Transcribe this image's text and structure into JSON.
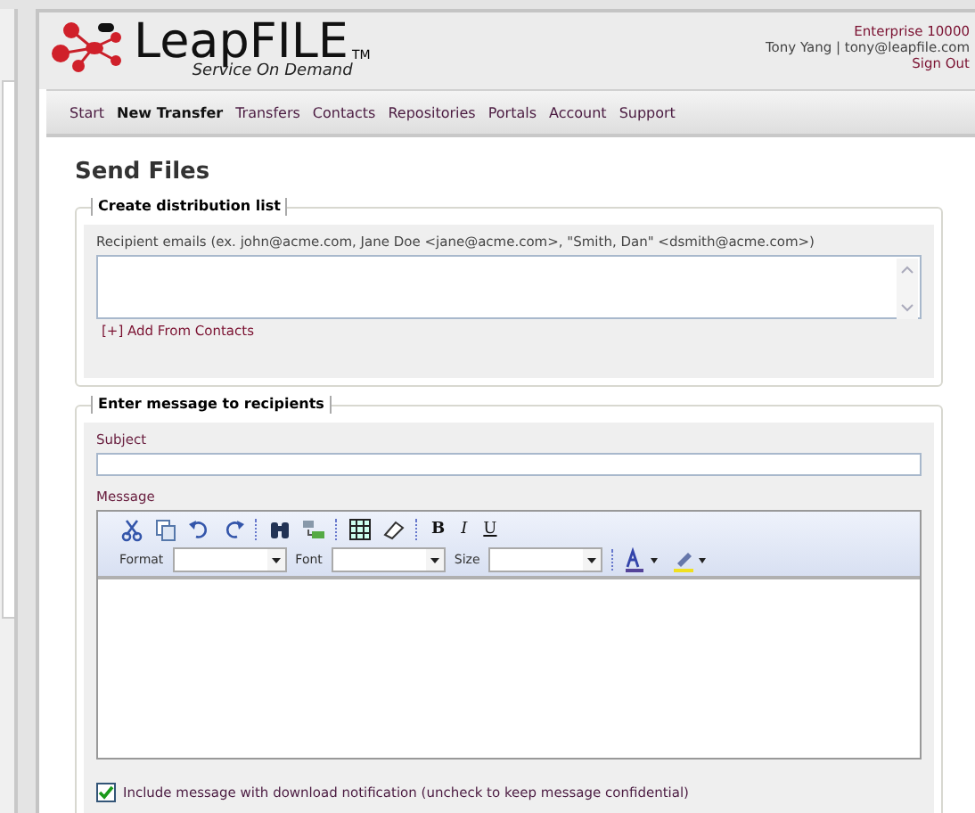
{
  "header": {
    "logo": {
      "name": "LeapFILE",
      "mark": "TM",
      "tagline": "Service On Demand"
    },
    "account": {
      "plan": "Enterprise 10000",
      "user": "Tony Yang | tony@leapfile.com",
      "sign_out": "Sign Out"
    }
  },
  "nav": [
    {
      "label": "Start",
      "selected": false
    },
    {
      "label": "New Transfer",
      "selected": true
    },
    {
      "label": "Transfers",
      "selected": false
    },
    {
      "label": "Contacts",
      "selected": false
    },
    {
      "label": "Repositories",
      "selected": false
    },
    {
      "label": "Portals",
      "selected": false
    },
    {
      "label": "Account",
      "selected": false
    },
    {
      "label": "Support",
      "selected": false
    }
  ],
  "page_title": "Send Files",
  "distribution": {
    "legend": "Create distribution list",
    "label": "Recipient emails (ex. john@acme.com, Jane Doe <jane@acme.com>, \"Smith, Dan\" <dsmith@acme.com>)",
    "add_link": "[+] Add From Contacts"
  },
  "message": {
    "legend": "Enter message to recipients",
    "subject_label": "Subject",
    "message_label": "Message",
    "styles": [
      "B",
      "I",
      "U"
    ],
    "dropdowns": [
      "Format",
      "Font",
      "Size"
    ],
    "notify": {
      "label": "Include message with download notification (uncheck to keep message confidential)",
      "checked": true
    }
  }
}
